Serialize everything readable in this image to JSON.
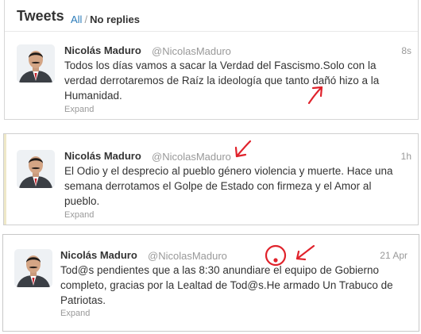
{
  "stream": {
    "title": "Tweets",
    "filter_all": "All",
    "filter_separator": "/",
    "filter_no_replies": "No replies"
  },
  "tweets": [
    {
      "name": "Nicolás Maduro",
      "handle": "@NicolasMaduro",
      "time": "8s",
      "text": "Todos los días vamos a sacar la Verdad del Fascismo.Solo con la verdad derrotaremos de Raíz la ideología que tanto dañó hizo a la Humanidad.",
      "action": "Expand"
    },
    {
      "name": "Nicolás Maduro",
      "handle": "@NicolasMaduro",
      "time": "1h",
      "text": "El Odio y el desprecio al pueblo género violencia y muerte. Hace una semana derrotamos el Golpe de Estado con firmeza y el Amor al pueblo.",
      "action": "Expand"
    },
    {
      "name": "Nicolás Maduro",
      "handle": "@NicolasMaduro",
      "time": "21 Apr",
      "text": "Tod@s pendientes que a las 8:30 anundiare el equipo de Gobierno completo, gracias por la Lealtad de Tod@s.He armado Un Trabuco de Patriotas.",
      "action": "Expand"
    }
  ],
  "annotations": {
    "color": "#e0222b"
  }
}
